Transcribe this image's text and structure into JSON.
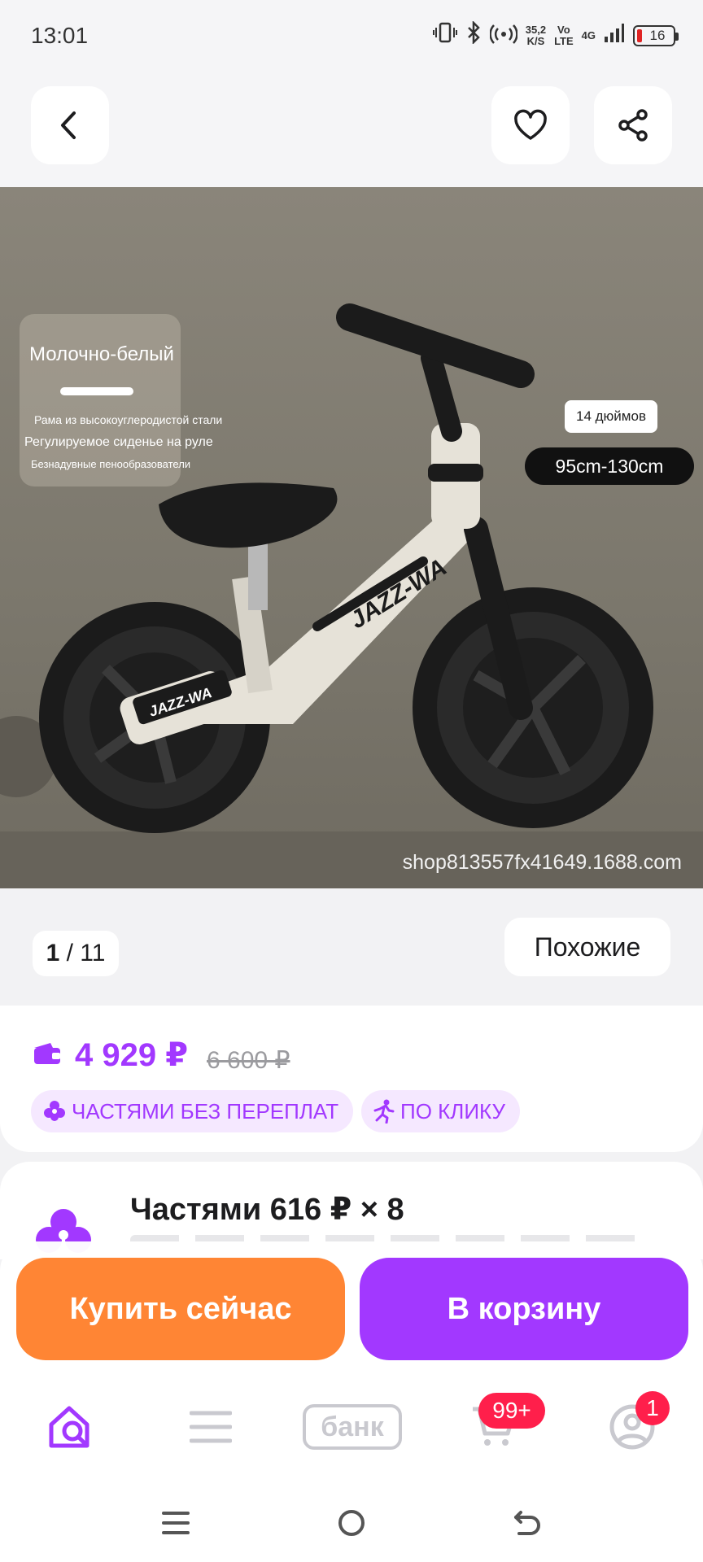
{
  "status_bar": {
    "time": "13:01",
    "speed_value": "35,2",
    "speed_unit": "K/S",
    "volte_top": "Vo",
    "volte_bottom": "LTE",
    "network": "4G",
    "battery_level": "16"
  },
  "top_bar": {
    "icons": [
      "back-icon",
      "heart-icon",
      "share-icon"
    ]
  },
  "gallery": {
    "color_name": "Молочно-белый",
    "feature_1": "Рама из высокоуглеродистой стали",
    "feature_2": "Регулируемое сиденье на руле",
    "feature_3": "Безнадувные пенообразователи",
    "wheel_size": "14 дюймов",
    "height_range": "95cm-130cm",
    "brand_frame": "JAZZ-WA",
    "brand_small": "JAZZ-WA",
    "watermark": "shop813557fx41649.1688.com"
  },
  "pager": {
    "current": "1",
    "separator": " / ",
    "total": "11",
    "similar_label": "Похожие"
  },
  "price": {
    "current": "4 929 ₽",
    "old": "6 600 ₽",
    "tag_installments": "ЧАСТЯМИ БЕЗ ПЕРЕПЛАТ",
    "tag_one_click": "ПО КЛИКУ",
    "accent_color": "#a238ff"
  },
  "installments": {
    "title": "Частями 616 ₽  ×  8"
  },
  "actions": {
    "buy_now": "Купить сейчас",
    "add_to_cart": "В корзину",
    "buy_color": "#ff8534",
    "cart_color": "#a238ff"
  },
  "bottom_nav": {
    "bank_label": "банк",
    "cart_badge": "99+",
    "profile_badge": "1"
  }
}
